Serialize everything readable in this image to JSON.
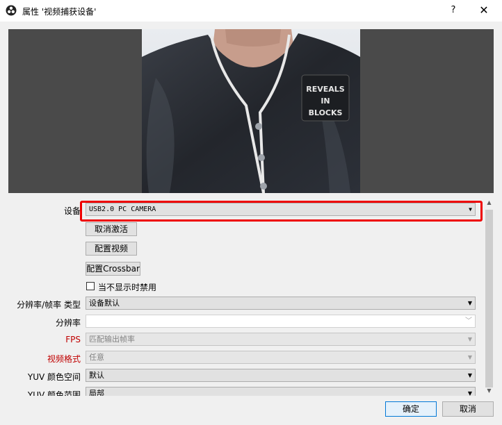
{
  "window": {
    "title": "属性 '视频捕获设备'",
    "help_label": "?",
    "close_label": "✕"
  },
  "preview": {
    "badge_lines": [
      "REVEALS",
      "IN",
      "BLOCKS"
    ]
  },
  "form": {
    "device": {
      "label": "设备",
      "value": "USB2.0 PC CAMERA"
    },
    "buttons": {
      "deactivate": "取消激活",
      "configure_video": "配置视频",
      "configure_crossbar": "配置Crossbar"
    },
    "checkbox": {
      "label": "当不显示时禁用",
      "checked": false
    },
    "res_fps_type": {
      "label": "分辨率/帧率 类型",
      "value": "设备默认"
    },
    "resolution": {
      "label": "分辨率",
      "value": ""
    },
    "fps": {
      "label": "FPS",
      "value": "匹配输出帧率"
    },
    "video_format": {
      "label": "视频格式",
      "value": "任意"
    },
    "yuv_space": {
      "label": "YUV 颜色空间",
      "value": "默认"
    },
    "yuv_range": {
      "label": "YUV 颜色范围",
      "value": "局部"
    }
  },
  "footer": {
    "ok": "确定",
    "cancel": "取消"
  },
  "colors": {
    "highlight": "#ee0000",
    "required_label": "#c00000",
    "preview_bg": "#4a4a4a"
  }
}
